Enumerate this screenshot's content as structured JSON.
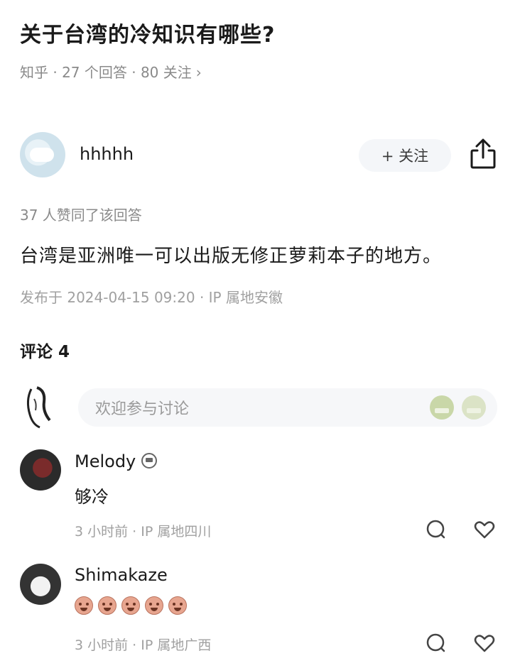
{
  "question": {
    "title": "关于台湾的冷知识有哪些?",
    "meta": "知乎 · 27 个回答 · 80 关注",
    "chevron": "›"
  },
  "answer": {
    "author": "hhhhh",
    "follow_label": "+ 关注",
    "likes_text": "37 人赞同了该回答",
    "content": "台湾是亚洲唯一可以出版无修正萝莉本子的地方。",
    "published": "发布于 2024-04-15 09:20 · IP 属地安徽"
  },
  "comments": {
    "header": "评论 4",
    "input_placeholder": "欢迎参与讨论",
    "items": [
      {
        "name": "Melody",
        "text": "够冷",
        "meta": "3 小时前 · IP 属地四川"
      },
      {
        "name": "Shimakaze",
        "text": "",
        "meta": "3 小时前 · IP 属地广西"
      }
    ]
  },
  "icons": {
    "share": "share-icon",
    "comment": "speech-bubble-icon",
    "like": "heart-icon",
    "sticker": "emoji-sticker-icon",
    "reaction": "sweating-face-emoji"
  },
  "colors": {
    "text_primary": "#1a1a1a",
    "text_secondary": "#8a8a8a",
    "follow_bg": "#f4f6f9",
    "input_bg": "#f6f7f9"
  }
}
